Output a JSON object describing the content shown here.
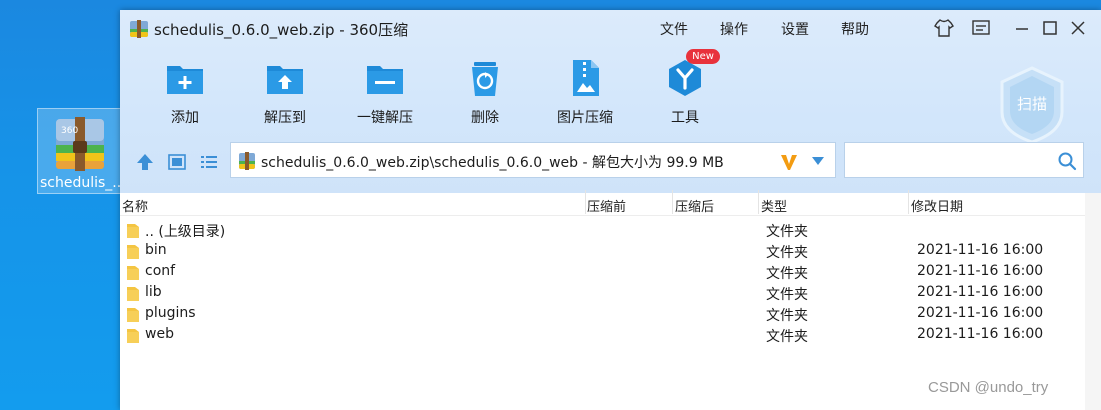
{
  "desktop": {
    "icon_label": "schedulis_..."
  },
  "window": {
    "title": "schedulis_0.6.0_web.zip - 360压缩",
    "menu": [
      "文件",
      "操作",
      "设置",
      "帮助"
    ]
  },
  "toolbar": {
    "items": [
      {
        "label": "添加",
        "icon": "add-folder-icon"
      },
      {
        "label": "解压到",
        "icon": "extract-to-icon"
      },
      {
        "label": "一键解压",
        "icon": "one-click-extract-icon"
      },
      {
        "label": "删除",
        "icon": "recycle-bin-icon"
      },
      {
        "label": "图片压缩",
        "icon": "image-compress-icon"
      },
      {
        "label": "工具",
        "icon": "tools-icon"
      }
    ],
    "new_badge": "New",
    "scan_label": "扫描"
  },
  "address": {
    "path": "schedulis_0.6.0_web.zip\\schedulis_0.6.0_web - 解包大小为 99.9 MB",
    "search_placeholder": ""
  },
  "columns": [
    "名称",
    "压缩前",
    "压缩后",
    "类型",
    "修改日期"
  ],
  "files": [
    {
      "name": ".. (上级目录)",
      "type": "文件夹",
      "modified": ""
    },
    {
      "name": "bin",
      "type": "文件夹",
      "modified": "2021-11-16 16:00"
    },
    {
      "name": "conf",
      "type": "文件夹",
      "modified": "2021-11-16 16:00"
    },
    {
      "name": "lib",
      "type": "文件夹",
      "modified": "2021-11-16 16:00"
    },
    {
      "name": "plugins",
      "type": "文件夹",
      "modified": "2021-11-16 16:00"
    },
    {
      "name": "web",
      "type": "文件夹",
      "modified": "2021-11-16 16:00"
    }
  ],
  "watermark": "CSDN @undo_try",
  "colors": {
    "desktop": "#1a8fe3",
    "chrome": "#d2e6fb",
    "accent": "#1e8ad8",
    "folder": "#f4c542",
    "badge": "#e8323c"
  }
}
